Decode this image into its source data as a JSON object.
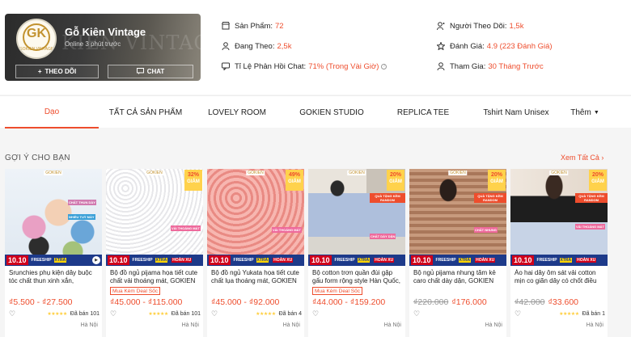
{
  "shop": {
    "name": "Gỗ Kiên Vintage",
    "online_status": "Online 3 phút trước",
    "banner_text": "KIÊN VINTAGE",
    "avatar_mark": "GK",
    "avatar_text": "GOKIEN VINTAGE",
    "follow_button": "THEO DÕI",
    "chat_button": "CHAT"
  },
  "stats": {
    "products_label": "Sản Phẩm:",
    "products_value": "72",
    "following_label": "Đang Theo:",
    "following_value": "2,5k",
    "chat_rate_label": "Tỉ Lệ Phản Hồi Chat:",
    "chat_rate_value": "71% (Trong Vài Giờ)",
    "followers_label": "Người Theo Dõi:",
    "followers_value": "1,5k",
    "rating_label": "Đánh Giá:",
    "rating_value": "4.9 (223 Đánh Giá)",
    "joined_label": "Tham Gia:",
    "joined_value": "30 Tháng Trước"
  },
  "tabs": {
    "items": [
      "Dạo",
      "TẤT CẢ SẢN PHẨM",
      "LOVELY ROOM",
      "GOKIEN STUDIO",
      "REPLICA TEE",
      "Tshirt Nam Unisex"
    ],
    "more": "Thêm",
    "active": "Dạo"
  },
  "section": {
    "title": "GỢI Ý CHO BẠN",
    "see_all": "Xem Tất Cả"
  },
  "promo": {
    "date": "10.10",
    "freeship": "FREESHIP",
    "xtra": "XTRA",
    "hoan": "HOÀN XU",
    "shop_logo": "GOKIEN",
    "discount_word": "GIẢM"
  },
  "products": [
    {
      "name": "Srunchies phụ kiện dây buộc tóc chất thun xinh xắn, GOKIEN VINTAGE",
      "price": "₫5.500 - ₫27.500",
      "old_price": "",
      "discount": "",
      "deal_badge": "",
      "stars": "★★★★★",
      "sold": "Đã bán 101",
      "location": "Hà Nội",
      "sticker1": "CHẤT THUN DÀY",
      "sticker2": "NHIỀU TUỲ MÀY"
    },
    {
      "name": "Bộ đồ ngủ pijama họa tiết cute chất vải thoáng mát, GOKIEN VINTAGE",
      "price": "₫45.000 - ₫115.000",
      "old_price": "",
      "discount": "32%",
      "deal_badge": "Mua Kèm Deal Sốc",
      "stars": "★★★★★",
      "sold": "Đã bán 101",
      "location": "Hà Nội",
      "sticker1": "VẢI THOÁNG MÁT",
      "sticker2": ""
    },
    {
      "name": "Bộ đồ ngủ Yukata họa tiết cute chất lụa thoáng mát, GOKIEN VINTAGE",
      "price": "₫45.000 - ₫92.000",
      "old_price": "",
      "discount": "49%",
      "deal_badge": "",
      "stars": "★★★★★",
      "sold": "Đã bán 4",
      "location": "Hà Nội",
      "sticker1": "VẢI THOÁNG MÁT",
      "sticker2": ""
    },
    {
      "name": "Bộ cotton trơn quần đùi gập gấu form rộng style Hàn Quốc, GOKIEN",
      "price": "₫44.000 - ₫159.200",
      "old_price": "",
      "discount": "20%",
      "deal_badge": "Mua Kèm Deal Sốc",
      "stars": "",
      "sold": "",
      "location": "Hà Nội",
      "sticker1": "QUÀ TẶNG KÈM RANDOM",
      "sticker2": "CHẤT DÀY DẶN"
    },
    {
      "name": "Bộ ngủ pijama nhung tăm kẻ caro chất dày dặn, GOKIEN VINTAGE",
      "price": "₫176.000",
      "old_price": "₫220.000",
      "discount": "20%",
      "deal_badge": "",
      "stars": "",
      "sold": "",
      "location": "Hà Nội",
      "sticker1": "QUÀ TẶNG KÈM RANDOM",
      "sticker2": "CHẤT NHUNG"
    },
    {
      "name": "Áo hai dây ôm sát vải cotton mịn co giãn dây có chốt điều chỉnh",
      "price": "₫33.600",
      "old_price": "₫42.000",
      "discount": "20%",
      "deal_badge": "",
      "stars": "★★★★★",
      "sold": "Đã bán 1",
      "location": "Hà Nội",
      "sticker1": "QUÀ TẶNG KÈM RANDOM",
      "sticker2": "VẢI THOÁNG MÁT"
    }
  ]
}
